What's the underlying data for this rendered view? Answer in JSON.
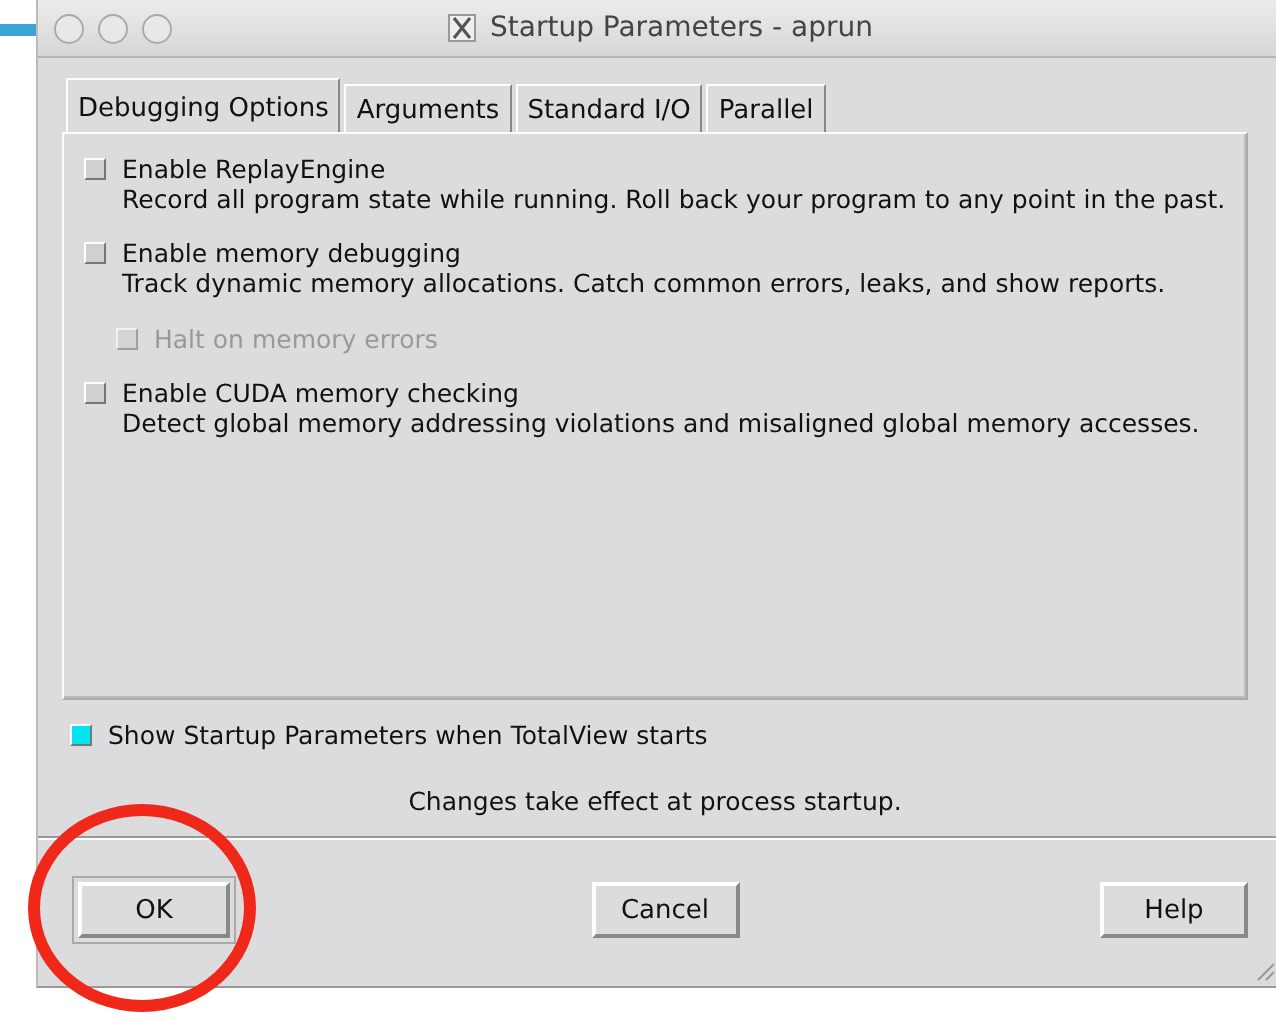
{
  "window": {
    "title": "Startup Parameters - aprun"
  },
  "tabs": [
    {
      "label": "Debugging Options",
      "selected": true
    },
    {
      "label": "Arguments",
      "selected": false
    },
    {
      "label": "Standard I/O",
      "selected": false
    },
    {
      "label": "Parallel",
      "selected": false
    }
  ],
  "options": [
    {
      "label": "Enable ReplayEngine",
      "description": "Record all program state while running.  Roll back your program to any point in the past.",
      "checked": false,
      "disabled": false
    },
    {
      "label": "Enable memory debugging",
      "description": "Track dynamic memory allocations.  Catch common errors, leaks, and show reports.",
      "checked": false,
      "disabled": false,
      "children": [
        {
          "label": "Halt on memory errors",
          "checked": false,
          "disabled": true
        }
      ]
    },
    {
      "label": "Enable CUDA memory checking",
      "description": "Detect global memory addressing violations and misaligned global memory accesses.",
      "checked": false,
      "disabled": false
    }
  ],
  "show_startup": {
    "label": "Show Startup Parameters when TotalView starts",
    "checked": true
  },
  "note": "Changes take effect at process startup.",
  "buttons": [
    "OK",
    "Cancel",
    "Help"
  ]
}
